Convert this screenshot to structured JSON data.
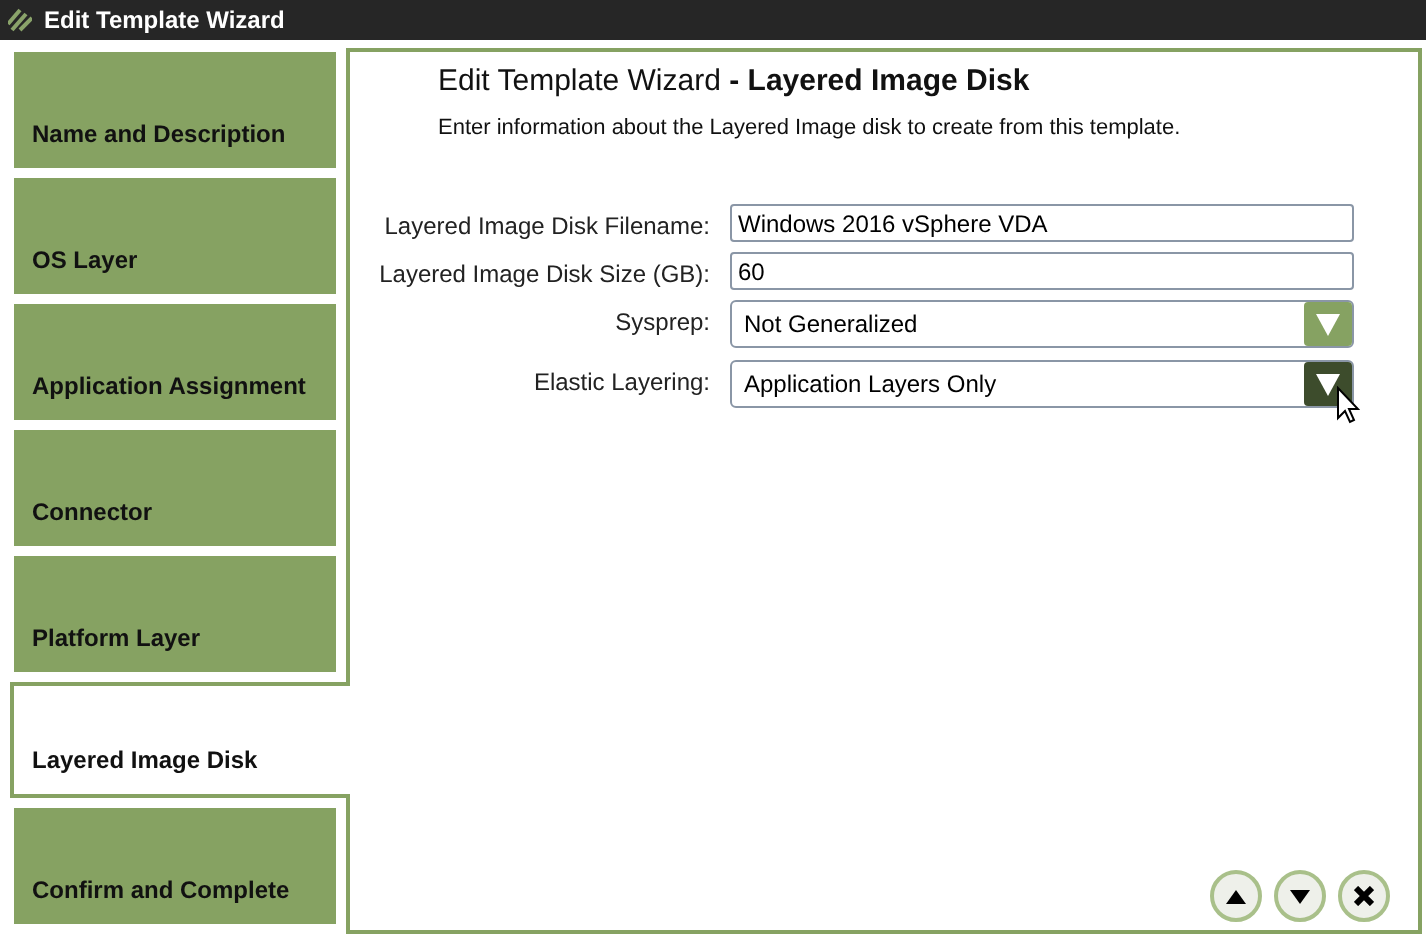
{
  "window": {
    "title": "Edit Template Wizard"
  },
  "steps": [
    {
      "label": "Name and Description",
      "selected": false
    },
    {
      "label": "OS Layer",
      "selected": false
    },
    {
      "label": "Application Assignment",
      "selected": false
    },
    {
      "label": "Connector",
      "selected": false
    },
    {
      "label": "Platform Layer",
      "selected": false
    },
    {
      "label": "Layered Image Disk",
      "selected": true
    },
    {
      "label": "Confirm and Complete",
      "selected": false
    }
  ],
  "panel": {
    "title_prefix": "Edit Template Wizard",
    "title_main": " - Layered Image Disk",
    "subtitle": "Enter information about the Layered Image disk to create from this template."
  },
  "fields": [
    {
      "kind": "text",
      "label": "Layered Image Disk Filename:",
      "value": "Windows 2016 vSphere VDA"
    },
    {
      "kind": "text",
      "label": "Layered Image Disk Size (GB):",
      "value": "60"
    },
    {
      "kind": "select",
      "label": "Sysprep:",
      "value": "Not Generalized",
      "hovered": false
    },
    {
      "kind": "select",
      "label": "Elastic Layering:",
      "value": "Application Layers Only",
      "hovered": true
    }
  ]
}
